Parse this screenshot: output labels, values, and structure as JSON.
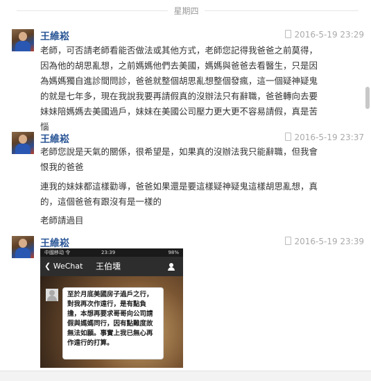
{
  "day_divider": "星期四",
  "messages": [
    {
      "sender": "王維崧",
      "time": "2016-5-19 23:29",
      "text": "老師，可否請老師看能否做法或其他方式，老師您記得我爸爸之前莫得，因為他的胡思亂想，之前媽媽他們去美國，媽媽與爸爸去看醫生，只是因為媽媽獨自進診間問診，爸爸就整個胡思亂想整個發瘋，這一個疑神疑鬼的就是七年多，現在我說我要再請假真的沒辦法只有辭職，爸爸轉向去要妹妹陪媽媽去美國過戶，妹妹在美國公司壓力更大更不容易請假，真是苦惱"
    },
    {
      "sender": "王維崧",
      "time": "2016-5-19 23:37",
      "paragraphs": [
        "老師您說是天氣的關係，很希望是，如果真的沒辦法我只能辭職，但我會恨我的爸爸",
        "連我的妹妹都這樣勸導，爸爸如果還是要這樣疑神疑鬼這樣胡思亂想，真的，這個爸爸有跟沒有是一樣的",
        "老師請過目"
      ]
    },
    {
      "sender": "王維崧",
      "time": "2016-5-19 23:39",
      "screenshot": {
        "carrier": "中國移动 令",
        "clock": "23:39",
        "battery": "98%",
        "back": "WeChat",
        "title": "王伯壎",
        "bubble_text": "至於月底美國房子過戶之行，對我再次作遠行，是有點負擔，本想再要求哥哥向公司請假與媽媽同行，因有點難度故無法如願。事實上我已無心再作遠行的打算。"
      }
    }
  ]
}
